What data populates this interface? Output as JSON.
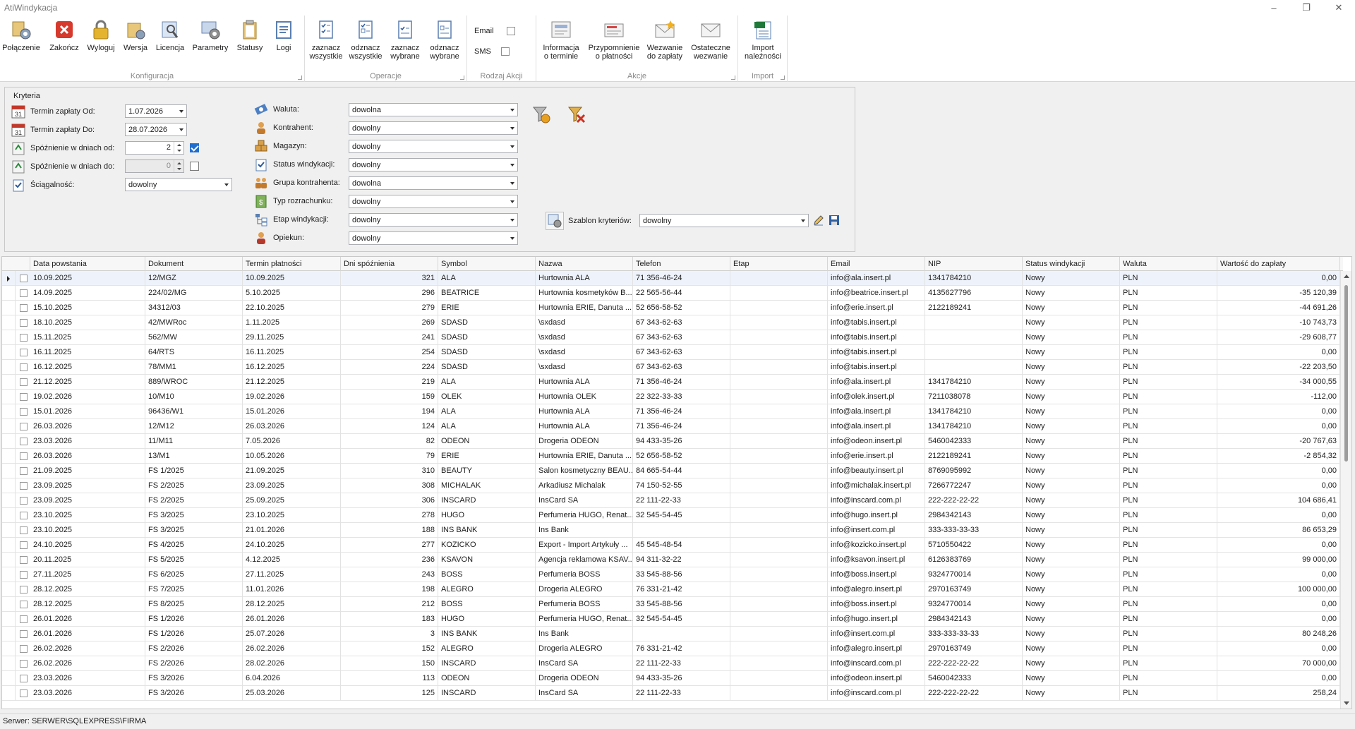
{
  "window": {
    "title": "AtiWindykacja",
    "minimize": "–",
    "maximize": "❐",
    "close": "✕"
  },
  "ribbon": {
    "groups": {
      "konfiguracja": "Konfiguracja",
      "operacje": "Operacje",
      "rodzaj_akcji": "Rodzaj Akcji",
      "akcje": "Akcje",
      "import": "Import"
    },
    "buttons": {
      "polaczenie": "Połączenie",
      "zakoncz": "Zakończ",
      "wyloguj": "Wyloguj",
      "wersja": "Wersja",
      "licencja": "Licencja",
      "parametry": "Parametry",
      "statusy": "Statusy",
      "logi": "Logi",
      "zaznacz_wszystkie": "zaznacz\nwszystkie",
      "odznacz_wszystkie": "odznacz\nwszystkie",
      "zaznacz_wybrane": "zaznacz\nwybrane",
      "odznacz_wybrane": "odznacz\nwybrane",
      "informacja": "Informacja\no terminie",
      "przypomnienie": "Przypomnienie\no płatności",
      "wezwanie": "Wezwanie\ndo zapłaty",
      "ostateczne": "Ostateczne\nwezwanie",
      "import": "Import\nnależności"
    },
    "checks": {
      "email": "Email",
      "sms": "SMS"
    }
  },
  "criteria": {
    "legend": "Kryteria",
    "termin_od_label": "Termin zapłaty Od:",
    "termin_od_value": "1.07.2026",
    "termin_do_label": "Termin zapłaty  Do:",
    "termin_do_value": "28.07.2026",
    "spoznienie_od_label": "Spóźnienie w dniach od:",
    "spoznienie_od_value": "2",
    "spoznienie_do_label": "Spóźnienie w dniach do:",
    "spoznienie_do_value": "0",
    "sciagalnosc_label": "Ściągalność:",
    "sciagalnosc_value": "dowolny",
    "waluta_label": "Waluta:",
    "waluta_value": "dowolna",
    "kontrahent_label": "Kontrahent:",
    "kontrahent_value": "dowolny",
    "magazyn_label": "Magazyn:",
    "magazyn_value": "dowolny",
    "status_label": "Status windykacji:",
    "status_value": "dowolny",
    "grupa_label": "Grupa kontrahenta:",
    "grupa_value": "dowolna",
    "typ_label": "Typ rozrachunku:",
    "typ_value": "dowolny",
    "etap_label": "Etap windykacji:",
    "etap_value": "dowolny",
    "opiekun_label": "Opiekun:",
    "opiekun_value": "dowolny",
    "szablon_label": "Szablon kryteriów:",
    "szablon_value": "dowolny"
  },
  "grid": {
    "columns": [
      "Data powstania",
      "Dokument",
      "Termin płatności",
      "Dni spóźnienia",
      "Symbol",
      "Nazwa",
      "Telefon",
      "Etap",
      "Email",
      "NIP",
      "Status windykacji",
      "Waluta",
      "Wartość do zapłaty"
    ],
    "rows": [
      [
        "10.09.2025",
        "12/MGZ",
        "10.09.2025",
        "321",
        "ALA",
        "Hurtownia ALA",
        "71 356-46-24",
        "",
        "info@ala.insert.pl",
        "1341784210",
        "Nowy",
        "PLN",
        "0,00"
      ],
      [
        "14.09.2025",
        "224/02/MG",
        "5.10.2025",
        "296",
        "BEATRICE",
        "Hurtownia kosmetyków B...",
        "22 565-56-44",
        "",
        "info@beatrice.insert.pl",
        "4135627796",
        "Nowy",
        "PLN",
        "-35 120,39"
      ],
      [
        "15.10.2025",
        "34312/03",
        "22.10.2025",
        "279",
        "ERIE",
        "Hurtownia ERIE, Danuta ...",
        "52 656-58-52",
        "",
        "info@erie.insert.pl",
        "2122189241",
        "Nowy",
        "PLN",
        "-44 691,26"
      ],
      [
        "18.10.2025",
        "42/MWRoc",
        "1.11.2025",
        "269",
        "SDASD",
        "\\sxdasd",
        "67 343-62-63",
        "",
        "info@tabis.insert.pl",
        "",
        "Nowy",
        "PLN",
        "-10 743,73"
      ],
      [
        "15.11.2025",
        "562/MW",
        "29.11.2025",
        "241",
        "SDASD",
        "\\sxdasd",
        "67 343-62-63",
        "",
        "info@tabis.insert.pl",
        "",
        "Nowy",
        "PLN",
        "-29 608,77"
      ],
      [
        "16.11.2025",
        "64/RTS",
        "16.11.2025",
        "254",
        "SDASD",
        "\\sxdasd",
        "67 343-62-63",
        "",
        "info@tabis.insert.pl",
        "",
        "Nowy",
        "PLN",
        "0,00"
      ],
      [
        "16.12.2025",
        "78/MM1",
        "16.12.2025",
        "224",
        "SDASD",
        "\\sxdasd",
        "67 343-62-63",
        "",
        "info@tabis.insert.pl",
        "",
        "Nowy",
        "PLN",
        "-22 203,50"
      ],
      [
        "21.12.2025",
        "889/WROC",
        "21.12.2025",
        "219",
        "ALA",
        "Hurtownia ALA",
        "71 356-46-24",
        "",
        "info@ala.insert.pl",
        "1341784210",
        "Nowy",
        "PLN",
        "-34 000,55"
      ],
      [
        "19.02.2026",
        "10/M10",
        "19.02.2026",
        "159",
        "OLEK",
        "Hurtownia OLEK",
        "22 322-33-33",
        "",
        "info@olek.insert.pl",
        "7211038078",
        "Nowy",
        "PLN",
        "-112,00"
      ],
      [
        "15.01.2026",
        "96436/W1",
        "15.01.2026",
        "194",
        "ALA",
        "Hurtownia ALA",
        "71 356-46-24",
        "",
        "info@ala.insert.pl",
        "1341784210",
        "Nowy",
        "PLN",
        "0,00"
      ],
      [
        "26.03.2026",
        "12/M12",
        "26.03.2026",
        "124",
        "ALA",
        "Hurtownia ALA",
        "71 356-46-24",
        "",
        "info@ala.insert.pl",
        "1341784210",
        "Nowy",
        "PLN",
        "0,00"
      ],
      [
        "23.03.2026",
        "11/M11",
        "7.05.2026",
        "82",
        "ODEON",
        "Drogeria ODEON",
        "94 433-35-26",
        "",
        "info@odeon.insert.pl",
        "5460042333",
        "Nowy",
        "PLN",
        "-20 767,63"
      ],
      [
        "26.03.2026",
        "13/M1",
        "10.05.2026",
        "79",
        "ERIE",
        "Hurtownia ERIE, Danuta ...",
        "52 656-58-52",
        "",
        "info@erie.insert.pl",
        "2122189241",
        "Nowy",
        "PLN",
        "-2 854,32"
      ],
      [
        "21.09.2025",
        "FS 1/2025",
        "21.09.2025",
        "310",
        "BEAUTY",
        "Salon kosmetyczny BEAU...",
        "84 665-54-44",
        "",
        "info@beauty.insert.pl",
        "8769095992",
        "Nowy",
        "PLN",
        "0,00"
      ],
      [
        "23.09.2025",
        "FS 2/2025",
        "23.09.2025",
        "308",
        "MICHALAK",
        "Arkadiusz Michalak",
        "74 150-52-55",
        "",
        "info@michalak.insert.pl",
        "7266772247",
        "Nowy",
        "PLN",
        "0,00"
      ],
      [
        "23.09.2025",
        "FS 2/2025",
        "25.09.2025",
        "306",
        "INSCARD",
        "InsCard SA",
        "22 111-22-33",
        "",
        "info@inscard.com.pl",
        "222-222-22-22",
        "Nowy",
        "PLN",
        "104 686,41"
      ],
      [
        "23.10.2025",
        "FS 3/2025",
        "23.10.2025",
        "278",
        "HUGO",
        "Perfumeria HUGO, Renat...",
        "32 545-54-45",
        "",
        "info@hugo.insert.pl",
        "2984342143",
        "Nowy",
        "PLN",
        "0,00"
      ],
      [
        "23.10.2025",
        "FS 3/2025",
        "21.01.2026",
        "188",
        "INS BANK",
        "Ins Bank",
        "",
        "",
        "info@insert.com.pl",
        "333-333-33-33",
        "Nowy",
        "PLN",
        "86 653,29"
      ],
      [
        "24.10.2025",
        "FS 4/2025",
        "24.10.2025",
        "277",
        "KOZICKO",
        "Export - Import Artykuły ...",
        "45 545-48-54",
        "",
        "info@kozicko.insert.pl",
        "5710550422",
        "Nowy",
        "PLN",
        "0,00"
      ],
      [
        "20.11.2025",
        "FS 5/2025",
        "4.12.2025",
        "236",
        "KSAVON",
        "Agencja reklamowa KSAV...",
        "94 311-32-22",
        "",
        "info@ksavon.insert.pl",
        "6126383769",
        "Nowy",
        "PLN",
        "99 000,00"
      ],
      [
        "27.11.2025",
        "FS 6/2025",
        "27.11.2025",
        "243",
        "BOSS",
        "Perfumeria BOSS",
        "33 545-88-56",
        "",
        "info@boss.insert.pl",
        "9324770014",
        "Nowy",
        "PLN",
        "0,00"
      ],
      [
        "28.12.2025",
        "FS 7/2025",
        "11.01.2026",
        "198",
        "ALEGRO",
        "Drogeria ALEGRO",
        "76 331-21-42",
        "",
        "info@alegro.insert.pl",
        "2970163749",
        "Nowy",
        "PLN",
        "100 000,00"
      ],
      [
        "28.12.2025",
        "FS 8/2025",
        "28.12.2025",
        "212",
        "BOSS",
        "Perfumeria BOSS",
        "33 545-88-56",
        "",
        "info@boss.insert.pl",
        "9324770014",
        "Nowy",
        "PLN",
        "0,00"
      ],
      [
        "26.01.2026",
        "FS 1/2026",
        "26.01.2026",
        "183",
        "HUGO",
        "Perfumeria HUGO, Renat...",
        "32 545-54-45",
        "",
        "info@hugo.insert.pl",
        "2984342143",
        "Nowy",
        "PLN",
        "0,00"
      ],
      [
        "26.01.2026",
        "FS 1/2026",
        "25.07.2026",
        "3",
        "INS BANK",
        "Ins Bank",
        "",
        "",
        "info@insert.com.pl",
        "333-333-33-33",
        "Nowy",
        "PLN",
        "80 248,26"
      ],
      [
        "26.02.2026",
        "FS 2/2026",
        "26.02.2026",
        "152",
        "ALEGRO",
        "Drogeria ALEGRO",
        "76 331-21-42",
        "",
        "info@alegro.insert.pl",
        "2970163749",
        "Nowy",
        "PLN",
        "0,00"
      ],
      [
        "26.02.2026",
        "FS 2/2026",
        "28.02.2026",
        "150",
        "INSCARD",
        "InsCard SA",
        "22 111-22-33",
        "",
        "info@inscard.com.pl",
        "222-222-22-22",
        "Nowy",
        "PLN",
        "70 000,00"
      ],
      [
        "23.03.2026",
        "FS 3/2026",
        "6.04.2026",
        "113",
        "ODEON",
        "Drogeria ODEON",
        "94 433-35-26",
        "",
        "info@odeon.insert.pl",
        "5460042333",
        "Nowy",
        "PLN",
        "0,00"
      ],
      [
        "23.03.2026",
        "FS 3/2026",
        "25.03.2026",
        "125",
        "INSCARD",
        "InsCard SA",
        "22 111-22-33",
        "",
        "info@inscard.com.pl",
        "222-222-22-22",
        "Nowy",
        "PLN",
        "258,24"
      ]
    ]
  },
  "status": {
    "server": "Serwer: SERWER\\SQLEXPRESS\\FIRMA"
  },
  "colors": {
    "selection": "#eef3fb",
    "accent": "#1f6ecf"
  }
}
